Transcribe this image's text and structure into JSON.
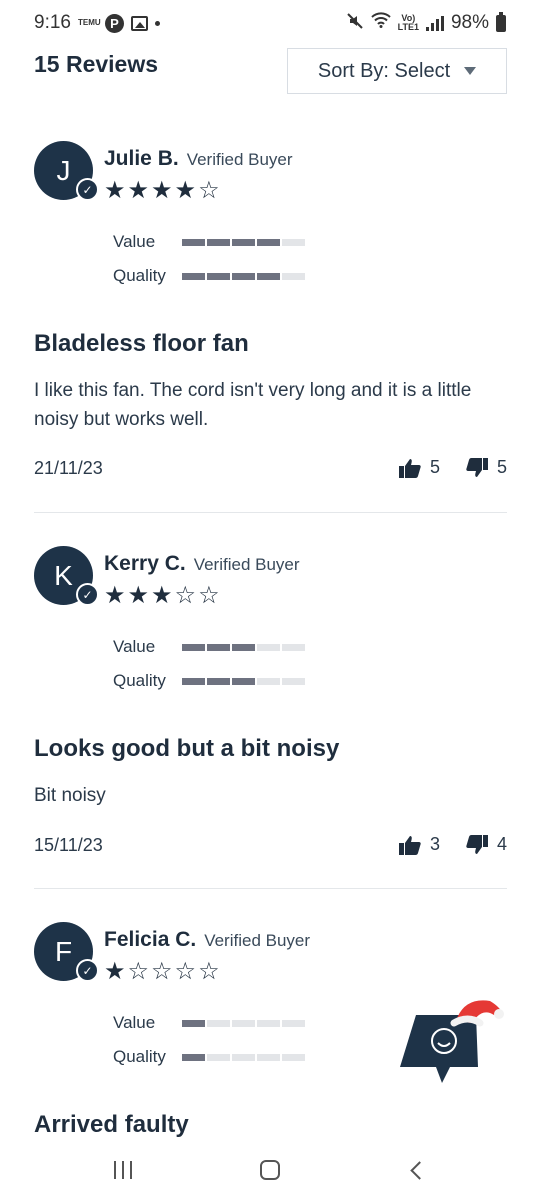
{
  "status_bar": {
    "time": "9:16",
    "temu_label": "TEMU",
    "battery": "98%",
    "lte_label": "LTE1"
  },
  "header": {
    "reviews_count": "15 Reviews",
    "sort_label": "Sort By: Select"
  },
  "reviews": [
    {
      "initial": "J",
      "name": "Julie B.",
      "verified": "Verified Buyer",
      "stars": 4,
      "value_label": "Value",
      "value_rating": 4,
      "quality_label": "Quality",
      "quality_rating": 4,
      "title": "Bladeless floor fan",
      "body": "I like this fan. The cord isn't very long and it is a little noisy but works well.",
      "date": "21/11/23",
      "helpful": "5",
      "not_helpful": "5"
    },
    {
      "initial": "K",
      "name": "Kerry C.",
      "verified": "Verified Buyer",
      "stars": 3,
      "value_label": "Value",
      "value_rating": 3,
      "quality_label": "Quality",
      "quality_rating": 3,
      "title": "Looks good but a bit noisy",
      "body": "Bit noisy",
      "date": "15/11/23",
      "helpful": "3",
      "not_helpful": "4"
    },
    {
      "initial": "F",
      "name": "Felicia C.",
      "verified": "Verified Buyer",
      "stars": 1,
      "value_label": "Value",
      "value_rating": 1,
      "quality_label": "Quality",
      "quality_rating": 1,
      "title": "Arrived faulty"
    }
  ],
  "icons": {
    "chat_widget": "chat-support-icon",
    "nav_recents": "recents-icon",
    "nav_home": "home-icon",
    "nav_back": "back-icon"
  },
  "colors": {
    "primary_dark": "#1e3348",
    "rating_on": "#6e7280",
    "rating_off": "#e3e5e8",
    "santa_red": "#e53935"
  }
}
